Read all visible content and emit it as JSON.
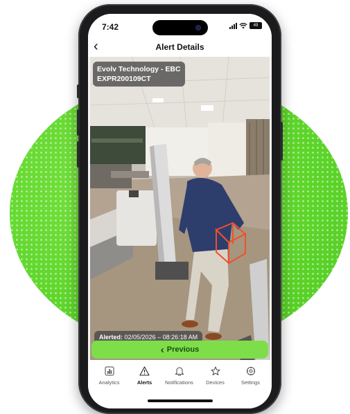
{
  "status_bar": {
    "time": "7:42",
    "battery": "49"
  },
  "nav": {
    "title": "Alert Details"
  },
  "camera": {
    "location": "Evolv Technology - EBC",
    "device_id": "EXPR200109CT",
    "alerted_label": "Alerted:",
    "alerted_value": "02/05/2026 – 08:26:18 AM"
  },
  "actions": {
    "previous_label": "Previous"
  },
  "tabs": [
    {
      "label": "Analytics",
      "icon": "analytics-icon"
    },
    {
      "label": "Alerts",
      "icon": "alert-triangle-icon"
    },
    {
      "label": "Notifications",
      "icon": "bell-icon"
    },
    {
      "label": "Devices",
      "icon": "star-icon"
    },
    {
      "label": "Settings",
      "icon": "gear-icon"
    }
  ],
  "colors": {
    "accent_green": "#7dde4a",
    "halo_green": "#5fd62c",
    "threat_box": "#f0502a"
  }
}
